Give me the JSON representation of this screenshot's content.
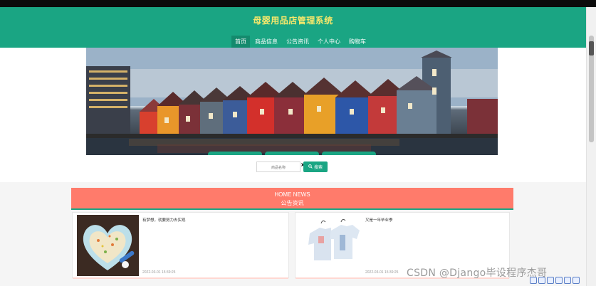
{
  "header": {
    "site_title": "母婴用品店管理系统",
    "nav": [
      {
        "label": "首页",
        "active": true
      },
      {
        "label": "商品信息",
        "active": false
      },
      {
        "label": "公告资讯",
        "active": false
      },
      {
        "label": "个人中心",
        "active": false
      },
      {
        "label": "购物车",
        "active": false
      }
    ]
  },
  "search": {
    "placeholder": "商品名称",
    "button_label": "搜索",
    "icon": "search-icon"
  },
  "news": {
    "title_en": "HOME NEWS",
    "title_cn": "公告资讯",
    "items": [
      {
        "title": "有梦想，就要努力去实现",
        "date": "2022-03-01 15:39:25",
        "image": "heart-bowl-food-photo"
      },
      {
        "title": "又是一年毕业季",
        "date": "2022-03-01 15:39:25",
        "image": "baby-clothes-photo"
      }
    ]
  },
  "watermark": "CSDN @Django毕设程序杰哥",
  "colors": {
    "brand_green": "#1aa583",
    "title_yellow": "#f7e86b",
    "news_header": "#ff7b6b",
    "top_bar": "#0b0b0b"
  }
}
